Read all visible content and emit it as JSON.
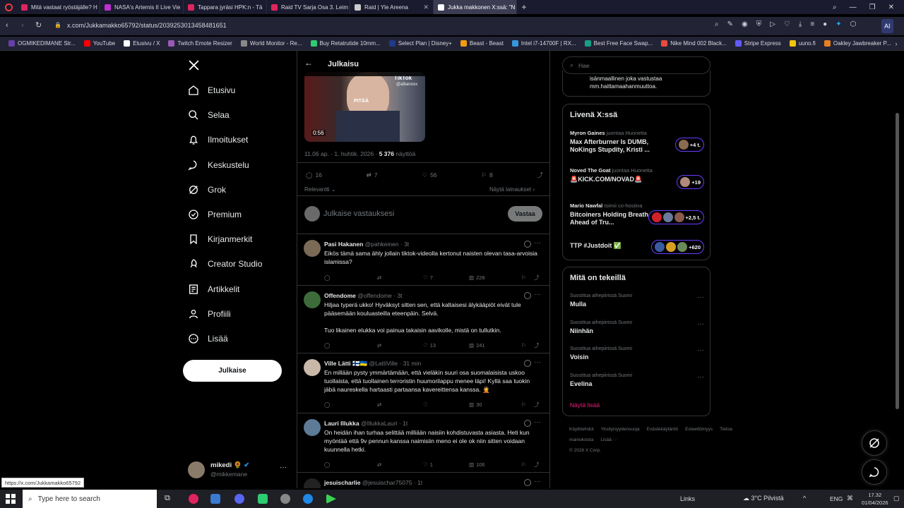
{
  "browser": {
    "tabs": [
      {
        "label": "Mitä vastaat ryöstäjälle? H",
        "color": "#e0245e",
        "active": false
      },
      {
        "label": "NASA's Artemis II Live Vie",
        "color": "#c02fd0",
        "active": false
      },
      {
        "label": "Tappara jyräsi HPK:n - Tä",
        "color": "#e0245e",
        "active": false
      },
      {
        "label": "Raid TV Sarja Osa 3. Leim",
        "color": "#e0245e",
        "active": false
      },
      {
        "label": "Raid | Yle Areena",
        "color": "#cccccc",
        "active": false
      },
      {
        "label": "Jukka makkonen X:ssä: \"N",
        "color": "#ffffff",
        "active": true
      }
    ],
    "url": "x.com/Jukkamakko65792/status/2039253013458481651",
    "bookmarks": [
      {
        "label": "OGMIKEDIMANE Str...",
        "color": "#6441a5"
      },
      {
        "label": "YouTube",
        "color": "#ff0000"
      },
      {
        "label": "Etusivu / X",
        "color": "#ffffff"
      },
      {
        "label": "Twitch Emote Resizer",
        "color": "#9b59b6"
      },
      {
        "label": "World Monitor - Re...",
        "color": "#888888"
      },
      {
        "label": "Buy Retatrutide 10mm...",
        "color": "#2ecc71"
      },
      {
        "label": "Select Plan | Disney+",
        "color": "#1e3a8a"
      },
      {
        "label": "Beast - Beast",
        "color": "#f39c12"
      },
      {
        "label": "Intel i7-14700F | RX...",
        "color": "#3498db"
      },
      {
        "label": "Best Free Face Swap...",
        "color": "#16a085"
      },
      {
        "label": "Nike Mind 002 Black...",
        "color": "#e74c3c"
      },
      {
        "label": "Stripe Express",
        "color": "#635bff"
      },
      {
        "label": "uuno.fi",
        "color": "#f1c40f"
      },
      {
        "label": "Oakley Jawbreaker P...",
        "color": "#e67e22"
      }
    ],
    "ai_label": "AI",
    "status_url": "https://x.com/Jukkamakko65792"
  },
  "sidebar": {
    "items": [
      {
        "label": "Etusivu",
        "icon": "home-icon"
      },
      {
        "label": "Selaa",
        "icon": "search-icon"
      },
      {
        "label": "Ilmoitukset",
        "icon": "bell-icon"
      },
      {
        "label": "Keskustelu",
        "icon": "chat-icon"
      },
      {
        "label": "Grok",
        "icon": "grok-icon"
      },
      {
        "label": "Premium",
        "icon": "verified-icon"
      },
      {
        "label": "Kirjanmerkit",
        "icon": "bookmark-icon"
      },
      {
        "label": "Creator Studio",
        "icon": "rocket-icon"
      },
      {
        "label": "Artikkelit",
        "icon": "article-icon"
      },
      {
        "label": "Profiili",
        "icon": "person-icon"
      },
      {
        "label": "Lisää",
        "icon": "more-icon"
      }
    ],
    "post_button": "Julkaise",
    "account": {
      "name": "mikedi",
      "handle": "@mikkemane"
    }
  },
  "main": {
    "header_title": "Julkaisu",
    "video_duration": "0:56",
    "video_caption": "PITÄÄ",
    "tiktok_label": "TikTok",
    "tiktok_handle": "@albanoxx",
    "timestamp": "11.06 ap. · 1. huhtik. 2026 ·",
    "views_count": "5 376",
    "views_label": "näyttöä",
    "stats": {
      "replies": "16",
      "reposts": "7",
      "likes": "56",
      "bookmarks": "8"
    },
    "sort_label": "Relevantti",
    "quotes_link": "Näytä lainaukset",
    "compose_placeholder": "Julkaise vastauksesi",
    "reply_button": "Vastaa",
    "replies": [
      {
        "name": "Pasi Hakanen",
        "handle": "@pahkeinen · 3t",
        "text": "Eikös tämä sama ähly jollain tiktok-videolla kertonut naisten olevan tasa-arvoisia islamissa?",
        "likes": "7",
        "views": "228",
        "reposts": "",
        "replies": "",
        "avatar": "#7b6a55"
      },
      {
        "name": "Offendome",
        "handle": "@offendome · 3t",
        "text": "Hiljaa typerä ukko! Hyväksyt sitten sen, että kaltaisesi älykääpiöt eivät tule pääsemään kouluasteilla eteenpäin. Selvä.",
        "text2": "Tuo likainen elukka voi painua takaisin aavikolle, mistä on tullutkin.",
        "likes": "13",
        "views": "241",
        "reposts": "",
        "replies": "",
        "avatar": "#3e6b3a"
      },
      {
        "name": "Ville Lätti 🇫🇮🇺🇦",
        "handle": "@LattiVille · 31 min",
        "text": "En millään pysty ymmärtämään, että vieläkin suuri osa suomalaisista uskoo tuollaista, että tuollainen terroristin huumorilappu menee läpi! Kyllä saa tuokin jäbä naureskella hartaasti partaansa kavereittensa kanssa. 🤦",
        "likes": "",
        "views": "30",
        "reposts": "",
        "replies": "",
        "avatar": "#c9b8a8"
      },
      {
        "name": "Lauri Illukka",
        "handle": "@IllukkaLauri · 1t",
        "text": "On heidän ihan turhaa selittää milliään naisiin kohdistuvasta asiasta. Heti kun myöntää että 9v pennun kanssa naimisiin meno ei ole ok niin sitten voidaan kuunnella hetki.",
        "likes": "1",
        "views": "106",
        "reposts": "",
        "replies": "",
        "avatar": "#5d7a96"
      },
      {
        "name": "jesuischarlie",
        "handle": "@jesuischar75075 · 1t",
        "text": "",
        "likes": "",
        "views": "",
        "reposts": "",
        "replies": "",
        "avatar": "#222222"
      }
    ]
  },
  "right": {
    "search_placeholder": "Hae",
    "top_snippet": "isänmaallinen joka vastustaa mm.haittamaahanmuuttoa.",
    "live": {
      "title": "Livenä X:ssä",
      "items": [
        {
          "host": "Myron Gaines",
          "role": "juontaa Huonetta",
          "title": "Max Afterburner Is DUMB, NoKings Stupdity, Kristi ...",
          "count": "+4 t.",
          "colors": [
            "#8a6a50"
          ]
        },
        {
          "host": "Noved The Goat",
          "role": "juontaa Huonetta",
          "title": "🚨KICK.COM/NOVAD🚨",
          "count": "+19",
          "colors": [
            "#b08a7a"
          ]
        },
        {
          "host": "Mario Nawfal",
          "role": "toimii co-hostina",
          "title": "Bitcoiners Holding Breath Ahead of Tru...",
          "count": "+2,5 t.",
          "colors": [
            "#d0202a",
            "#6a7a9a",
            "#8a5a4a"
          ]
        },
        {
          "host": "",
          "role": "",
          "title": "TTP #Justdoit ✅",
          "count": "+620",
          "colors": [
            "#3a5aa0",
            "#d8a020",
            "#6a8a5a"
          ]
        }
      ]
    },
    "trends": {
      "title": "Mitä on tekeillä",
      "items": [
        {
          "context": "Suosittua aihepiirissä Suomi",
          "name": "Mulla"
        },
        {
          "context": "Suosittua aihepiirissä Suomi",
          "name": "Niinhän"
        },
        {
          "context": "Suosittua aihepiirissä Suomi",
          "name": "Voisin"
        },
        {
          "context": "Suosittua aihepiirissä Suomi",
          "name": "Evelina"
        }
      ],
      "show_more": "Näytä lisää"
    },
    "footer": {
      "links": [
        "Käyttöehdot",
        "Yksityisyydensuoja",
        "Evästekäytäntö",
        "Esteettömyys",
        "Tietoa mainoksista",
        "Lisää ···"
      ],
      "copyright": "© 2026 X Corp."
    }
  },
  "taskbar": {
    "search_placeholder": "Type here to search",
    "links_label": "Links",
    "weather": "3°C  Pilvistä",
    "lang": "ENG",
    "time": "17.32",
    "date": "01/04/2026"
  },
  "colors": {
    "accent": "#1d9bf0",
    "live_border": "#6b3cff",
    "show_more": "#f91880"
  }
}
